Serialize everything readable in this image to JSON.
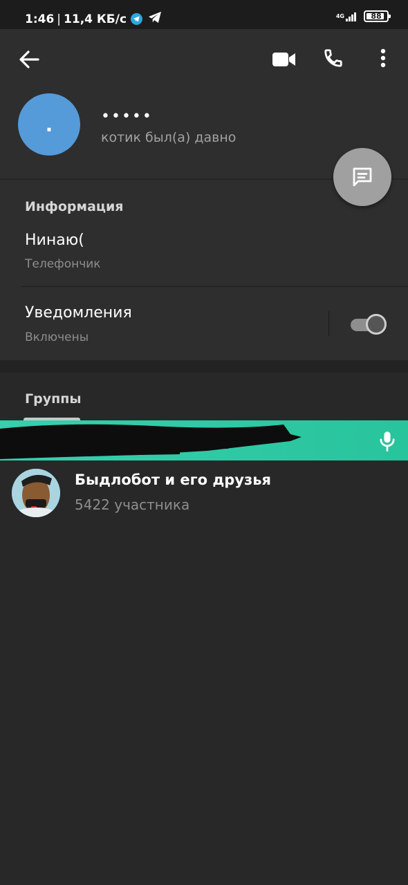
{
  "status_bar": {
    "time": "1:46",
    "speed": "11,4 КБ/с",
    "network": "4G",
    "battery": "88",
    "battery_level": 0.88
  },
  "header": {
    "back_icon": "arrow-left-icon",
    "video_icon": "video-camera-icon",
    "call_icon": "phone-icon",
    "more_icon": "more-vertical-icon",
    "avatar_text": ".",
    "avatar_color": "#559ad9",
    "name": "•••••",
    "status": "котик был(а) давно"
  },
  "fab": {
    "icon": "message-icon",
    "color": "#a0a0a0"
  },
  "info": {
    "title": "Информация",
    "bio": "Нинаю(",
    "bio_label": "Телефончик",
    "notifications_title": "Уведомления",
    "notifications_value": "Включены",
    "notifications_enabled": true
  },
  "groups": {
    "title": "Группы",
    "items": [
      {
        "name": "Быдлобот и его друзья",
        "members": "5422 участника"
      }
    ]
  },
  "voice_bar": {
    "icon": "microphone-icon",
    "color": "#2fc9a5"
  }
}
